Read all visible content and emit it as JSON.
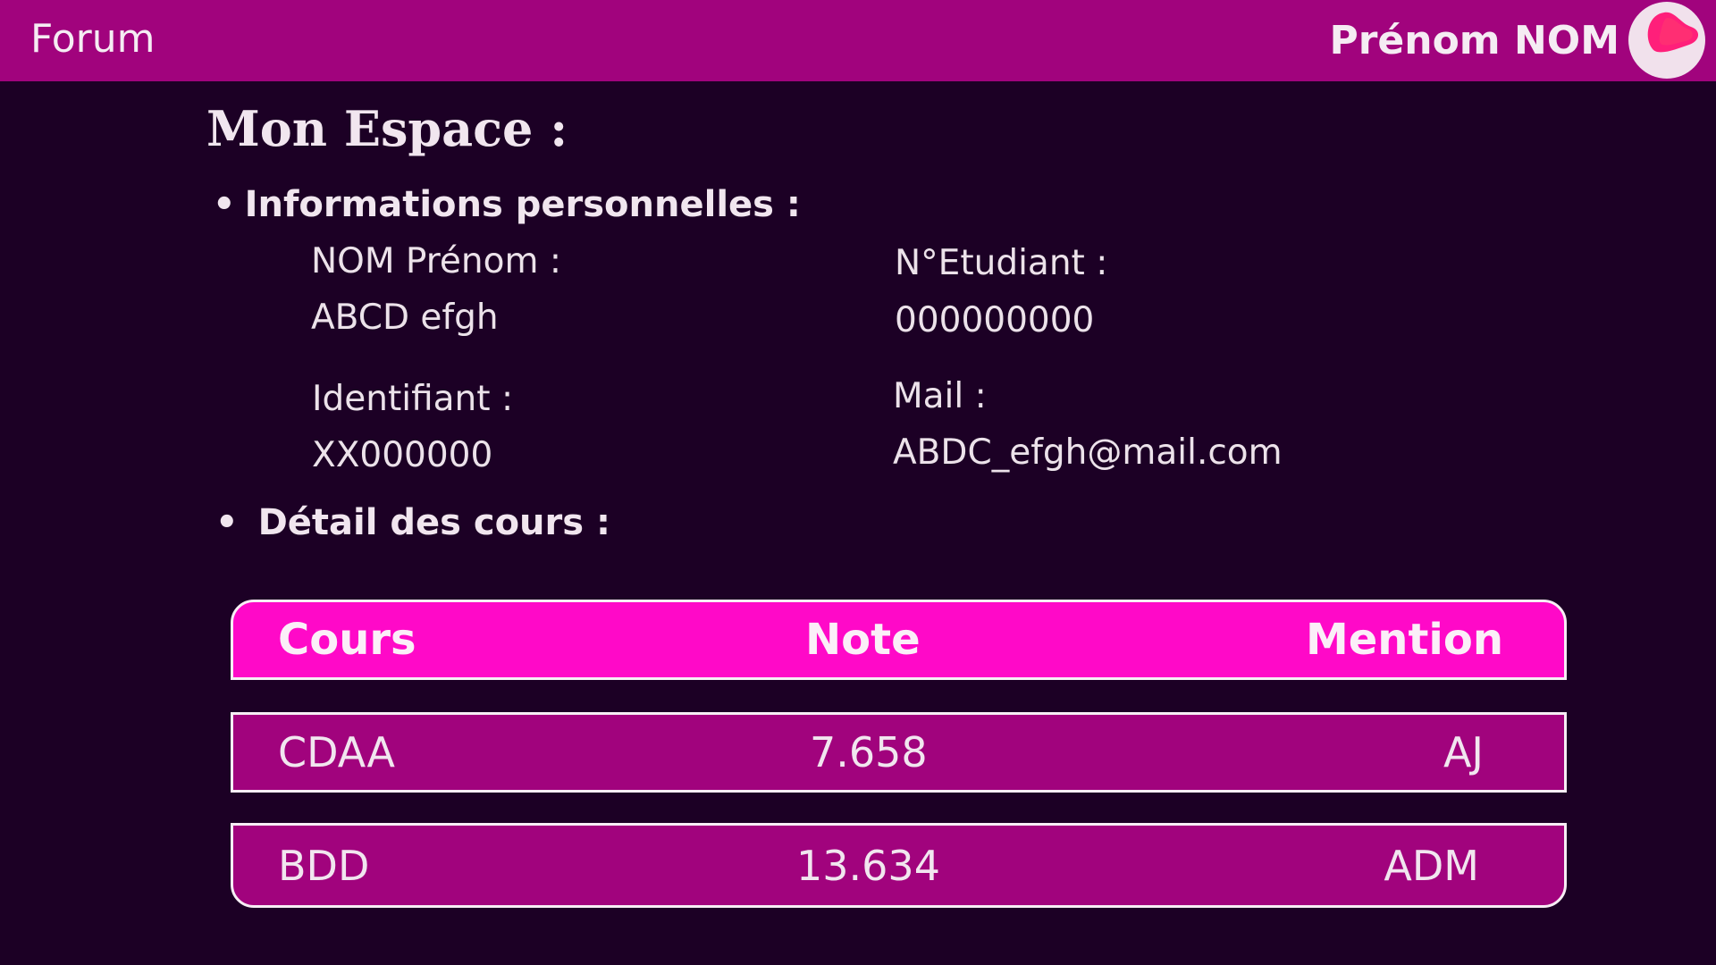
{
  "header": {
    "nav_link": "Forum",
    "user_name": "Prénom NOM",
    "avatar_icon": "blob-logo-icon",
    "colors": {
      "bar": "#a1037d",
      "avatar_bg": "#f1e1ec",
      "logo": "#ff1f7a"
    }
  },
  "page": {
    "title": "Mon Espace :",
    "background": "#1c0025"
  },
  "personal_info": {
    "heading": "Informations personnelles :",
    "name_label": "NOM Prénom :",
    "name_value": "ABCD efgh",
    "student_number_label": "N°Etudiant :",
    "student_number_value": "000000000",
    "identifier_label": "Identifiant :",
    "identifier_value": "XX000000",
    "mail_label": "Mail :",
    "mail_value": "ABDC_efgh@mail.com"
  },
  "courses": {
    "heading": "Détail des cours :",
    "columns": [
      "Cours",
      "Note",
      "Mention"
    ],
    "rows": [
      {
        "course": "CDAA",
        "grade": "7.658",
        "mention": "AJ"
      },
      {
        "course": "BDD",
        "grade": "13.634",
        "mention": "ADM"
      }
    ],
    "colors": {
      "header": "#ff09c8",
      "row": "#a1037d",
      "border": "#f7eef5"
    }
  }
}
